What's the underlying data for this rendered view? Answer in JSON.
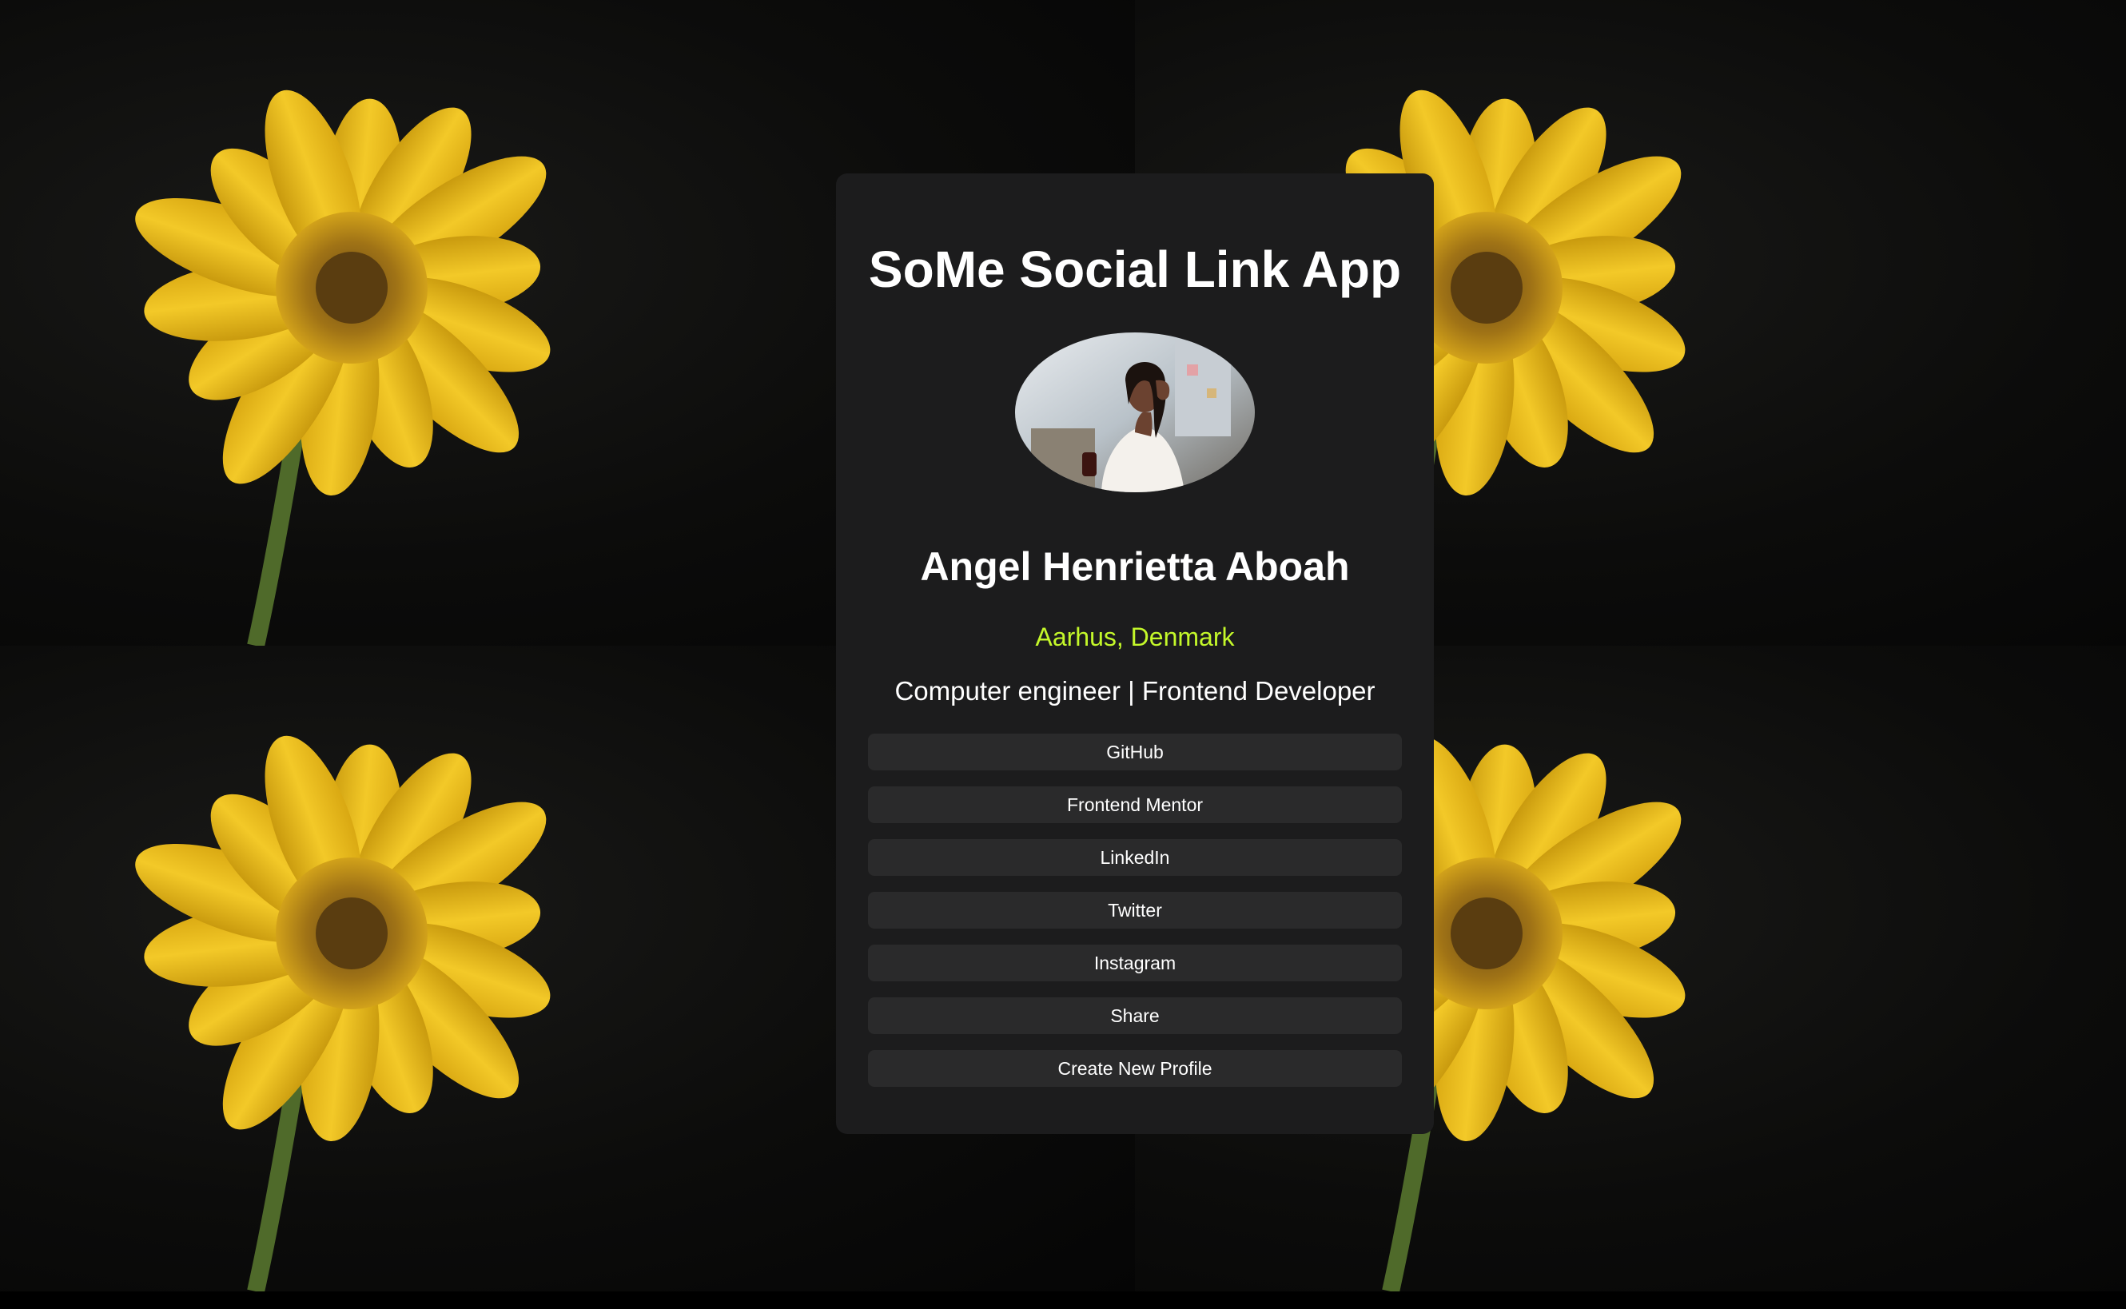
{
  "app": {
    "title": "SoMe Social Link App"
  },
  "profile": {
    "name": "Angel Henrietta Aboah",
    "location": "Aarhus, Denmark",
    "bio": "Computer engineer | Frontend Developer",
    "avatar_alt": "profile photo"
  },
  "links": [
    {
      "label": "GitHub"
    },
    {
      "label": "Frontend Mentor"
    },
    {
      "label": "LinkedIn"
    },
    {
      "label": "Twitter"
    },
    {
      "label": "Instagram"
    },
    {
      "label": "Share"
    },
    {
      "label": "Create New Profile"
    }
  ],
  "colors": {
    "card_background": "#1c1c1d",
    "button_background": "#2a2a2b",
    "accent": "#c4f82a",
    "text": "#ffffff",
    "page_background": "#000000"
  }
}
